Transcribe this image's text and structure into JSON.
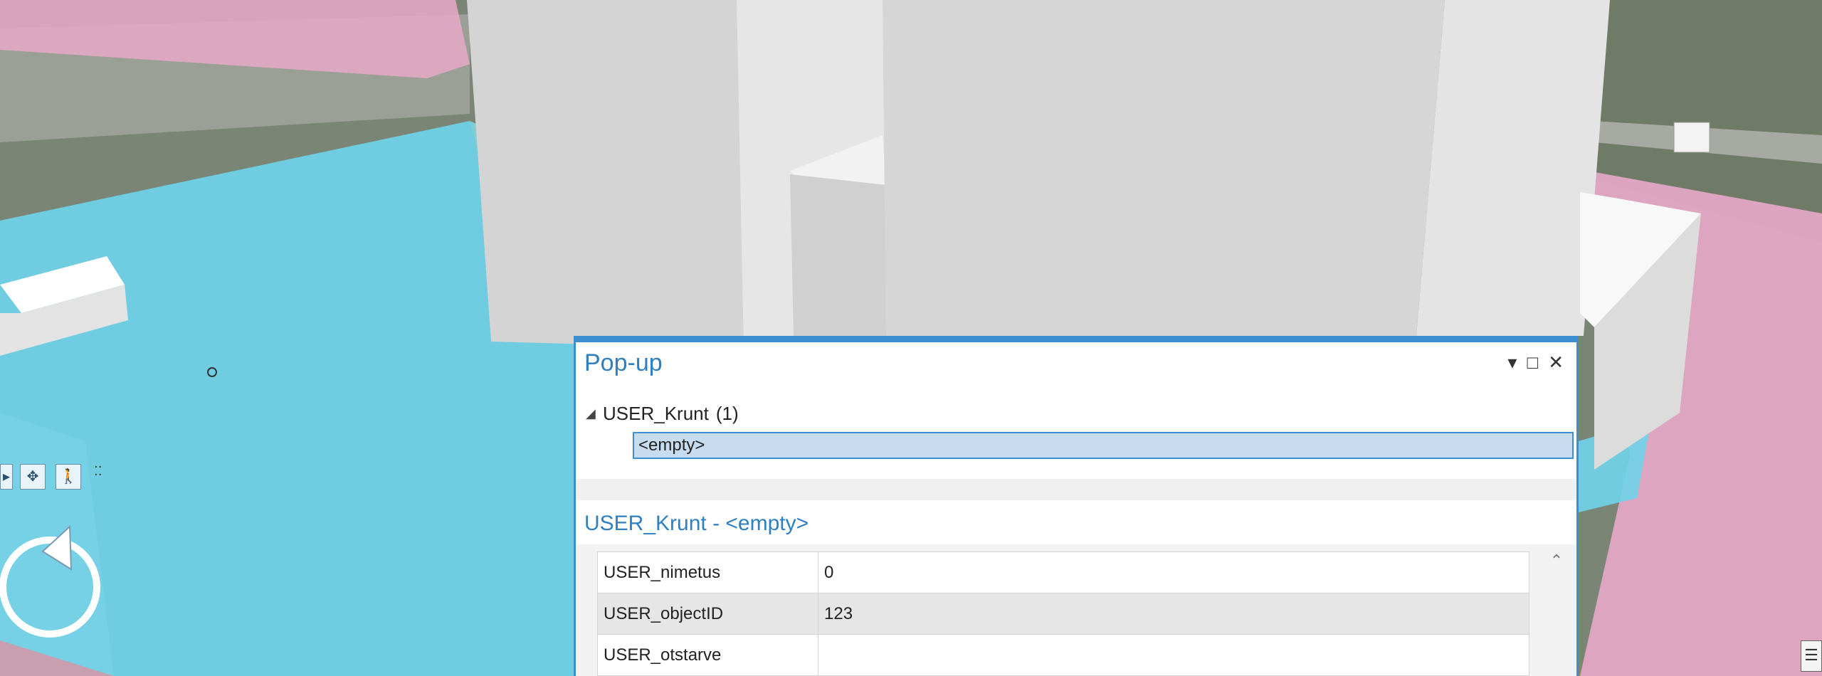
{
  "popup": {
    "title": "Pop-up",
    "controls": {
      "pin": "▾",
      "maximize": "□",
      "close": "✕"
    },
    "tree": {
      "layer_label": "USER_Krunt",
      "layer_count": "(1)",
      "feature_label": "<empty>"
    },
    "detail_title": "USER_Krunt - <empty>",
    "attributes": [
      {
        "key": "USER_nimetus",
        "value": "0"
      },
      {
        "key": "USER_objectID",
        "value": "123"
      },
      {
        "key": "USER_otstarve",
        "value": ""
      }
    ]
  },
  "map": {
    "colors": {
      "water": "#6fd4ea",
      "zoning": "#e8a9c8",
      "building": "#d9d9d9",
      "accent": "#3c8fd0"
    },
    "nav_icons": [
      "pan-icon",
      "move-icon",
      "walk-icon",
      "dots-icon"
    ],
    "compass_icon": "rotate-compass-icon"
  }
}
